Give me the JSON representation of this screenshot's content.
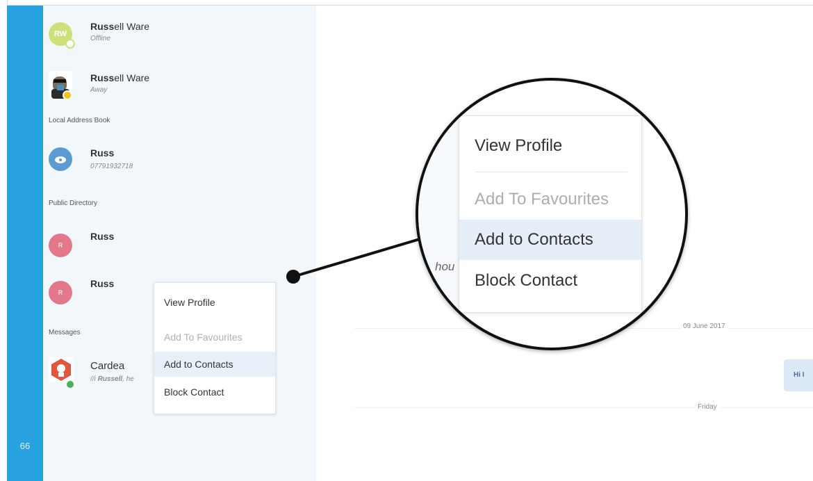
{
  "rail": {
    "badge_count": "66"
  },
  "contacts": [
    {
      "name_bold": "Russ",
      "name_rest": "ell Ware",
      "subtitle": "Offline",
      "avatar_initials": "RW"
    },
    {
      "name_bold": "Russ",
      "name_rest": "ell Ware",
      "subtitle": "Away"
    }
  ],
  "sections": {
    "local_address_book": "Local Address Book",
    "public_directory": "Public Directory",
    "messages": "Messages"
  },
  "local_contact": {
    "name": "Russ",
    "phone": "07791932718"
  },
  "public_contacts": [
    {
      "name": "Russ",
      "avatar_initials": "R"
    },
    {
      "name": "Russ",
      "avatar_initials": "R"
    }
  ],
  "message_thread": {
    "name": "Cardea",
    "preview_bold": "Russell",
    "preview_prefix": "//i ",
    "preview_rest": ", he"
  },
  "context_menu": {
    "items": [
      "View Profile",
      "Add To Favourites",
      "Add to Contacts",
      "Block Contact"
    ]
  },
  "zoom": {
    "items": [
      "View Profile",
      "Add To Favourites",
      "Add to Contacts",
      "Block Contact"
    ],
    "fragment": "hou"
  },
  "chat": {
    "date_label": "09 June 2017",
    "friday_label": "Friday",
    "bubble_text": "Hi I"
  },
  "colors": {
    "rail": "#29a3e0",
    "sidebar_bg": "#f2f7fc",
    "highlight": "#e8f1fa",
    "status_away": "#f0c419",
    "status_online": "#4caf50"
  }
}
